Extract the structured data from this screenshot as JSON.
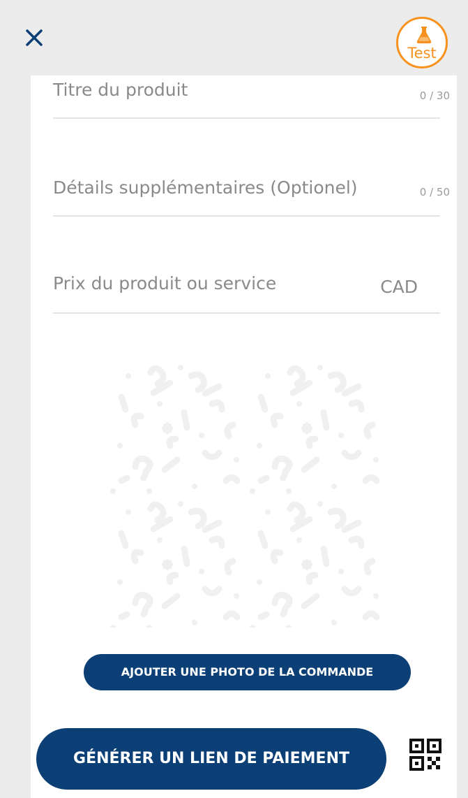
{
  "form": {
    "title_placeholder": "Titre du produit",
    "title_counter": "0 / 30",
    "details_placeholder": "Détails supplémentaires (Optionel)",
    "details_counter": "0 / 50",
    "price_placeholder": "Prix du produit ou service",
    "price_currency": "CAD"
  },
  "badge": {
    "label": "Test",
    "color": "#f7921e"
  },
  "buttons": {
    "add_photo_label": "AJOUTER UNE PHOTO DE LA COMMANDE",
    "generate_link_label": "GÉNÉRER UN LIEN DE PAIEMENT",
    "primary_color": "#0b3f75"
  },
  "icons": {
    "close": "close-icon",
    "test": "flask-icon",
    "qr": "qr-code-icon",
    "placeholder_image": "question-pattern-icon"
  }
}
